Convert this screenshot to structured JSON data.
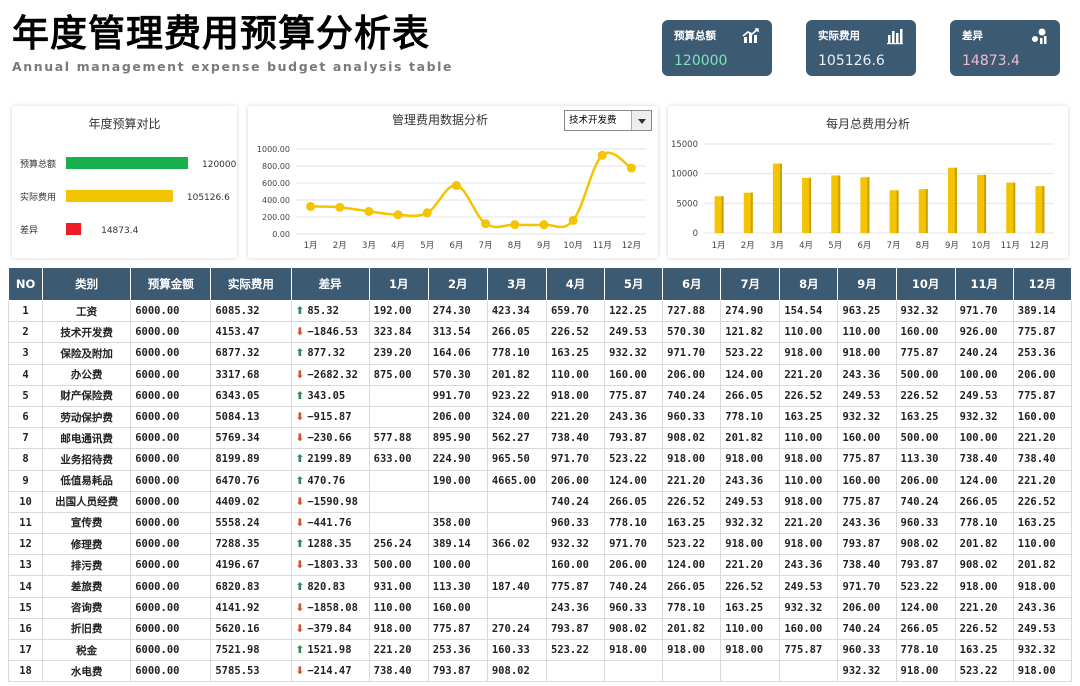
{
  "header": {
    "title": "年度管理费用预算分析表",
    "subtitle": "Annual management expense budget analysis table"
  },
  "kpis": [
    {
      "label": "预算总额",
      "value": "120000",
      "value_color": "#7ee0c0",
      "icon": "bar-chart-icon"
    },
    {
      "label": "实际费用",
      "value": "105126.6",
      "value_color": "#e6f0f5",
      "icon": "column-chart-icon"
    },
    {
      "label": "差异",
      "value": "14873.4",
      "value_color": "#f4b8d8",
      "icon": "scatter-chart-icon"
    }
  ],
  "panel_left": {
    "title": "年度预算对比",
    "items": [
      {
        "label": "预算总额",
        "value": 120000,
        "value_text": "120000",
        "color": "#17b04c"
      },
      {
        "label": "实际费用",
        "value": 105126.6,
        "value_text": "105126.6",
        "color": "#f5c400"
      },
      {
        "label": "差异",
        "value": 14873.4,
        "value_text": "14873.4",
        "color": "#ee1c25"
      }
    ],
    "max": 120000
  },
  "panel_mid": {
    "title": "管理费用数据分析",
    "selected": "技术开发费"
  },
  "panel_right": {
    "title": "每月总费用分析"
  },
  "chart_data": [
    {
      "type": "bar",
      "title": "年度预算对比",
      "categories": [
        "预算总额",
        "实际费用",
        "差异"
      ],
      "values": [
        120000,
        105126.6,
        14873.4
      ]
    },
    {
      "type": "line",
      "title": "管理费用数据分析",
      "series_selector": "技术开发费",
      "categories": [
        "1月",
        "2月",
        "3月",
        "4月",
        "5月",
        "6月",
        "7月",
        "8月",
        "9月",
        "10月",
        "11月",
        "12月"
      ],
      "values": [
        323.84,
        313.54,
        266.05,
        226.52,
        249.53,
        570.3,
        121.82,
        110.0,
        110.0,
        160.0,
        926.0,
        775.87
      ],
      "ylim": [
        0,
        1000
      ],
      "yticks": [
        "1000.00",
        "800.00",
        "600.00",
        "400.00",
        "200.00",
        "0.00"
      ],
      "color": "#f5c400",
      "grid": true
    },
    {
      "type": "bar",
      "title": "每月总费用分析",
      "categories": [
        "1月",
        "2月",
        "3月",
        "4月",
        "5月",
        "6月",
        "7月",
        "8月",
        "9月",
        "10月",
        "11月",
        "12月"
      ],
      "values": [
        6200,
        6800,
        11700,
        9300,
        9700,
        9400,
        7200,
        7400,
        11000,
        9800,
        8500,
        7900
      ],
      "ylim": [
        0,
        15000
      ],
      "yticks": [
        "15000",
        "10000",
        "5000",
        "0"
      ],
      "color": "#f5c400",
      "grid": true
    }
  ],
  "table": {
    "headers": [
      "NO",
      "类别",
      "预算金额",
      "实际费用",
      "差异",
      "1月",
      "2月",
      "3月",
      "4月",
      "5月",
      "6月",
      "7月",
      "8月",
      "9月",
      "10月",
      "11月",
      "12月"
    ],
    "rows": [
      [
        "1",
        "工资",
        "6000.00",
        "6085.32",
        "85.32",
        "192.00",
        "274.30",
        "423.34",
        "659.70",
        "122.25",
        "727.88",
        "274.90",
        "154.54",
        "963.25",
        "932.32",
        "971.70",
        "389.14"
      ],
      [
        "2",
        "技术开发费",
        "6000.00",
        "4153.47",
        "-1846.53",
        "323.84",
        "313.54",
        "266.05",
        "226.52",
        "249.53",
        "570.30",
        "121.82",
        "110.00",
        "110.00",
        "160.00",
        "926.00",
        "775.87"
      ],
      [
        "3",
        "保险及附加",
        "6000.00",
        "6877.32",
        "877.32",
        "239.20",
        "164.06",
        "778.10",
        "163.25",
        "932.32",
        "971.70",
        "523.22",
        "918.00",
        "918.00",
        "775.87",
        "240.24",
        "253.36"
      ],
      [
        "4",
        "办公费",
        "6000.00",
        "3317.68",
        "-2682.32",
        "875.00",
        "570.30",
        "201.82",
        "110.00",
        "160.00",
        "206.00",
        "124.00",
        "221.20",
        "243.36",
        "500.00",
        "100.00",
        "206.00"
      ],
      [
        "5",
        "财产保险费",
        "6000.00",
        "6343.05",
        "343.05",
        "",
        "991.70",
        "923.22",
        "918.00",
        "775.87",
        "740.24",
        "266.05",
        "226.52",
        "249.53",
        "226.52",
        "249.53",
        "775.87"
      ],
      [
        "6",
        "劳动保护费",
        "6000.00",
        "5084.13",
        "-915.87",
        "",
        "206.00",
        "324.00",
        "221.20",
        "243.36",
        "960.33",
        "778.10",
        "163.25",
        "932.32",
        "163.25",
        "932.32",
        "160.00"
      ],
      [
        "7",
        "邮电通讯费",
        "6000.00",
        "5769.34",
        "-230.66",
        "577.88",
        "895.90",
        "562.27",
        "738.40",
        "793.87",
        "908.02",
        "201.82",
        "110.00",
        "160.00",
        "500.00",
        "100.00",
        "221.20"
      ],
      [
        "8",
        "业务招待费",
        "6000.00",
        "8199.89",
        "2199.89",
        "633.00",
        "224.90",
        "965.50",
        "971.70",
        "523.22",
        "918.00",
        "918.00",
        "918.00",
        "775.87",
        "113.30",
        "738.40",
        "738.40"
      ],
      [
        "9",
        "低值易耗品",
        "6000.00",
        "6470.76",
        "470.76",
        "",
        "190.00",
        "4665.00",
        "206.00",
        "124.00",
        "221.20",
        "243.36",
        "110.00",
        "160.00",
        "206.00",
        "124.00",
        "221.20"
      ],
      [
        "10",
        "出国人员经费",
        "6000.00",
        "4409.02",
        "-1590.98",
        "",
        "",
        "",
        "740.24",
        "266.05",
        "226.52",
        "249.53",
        "918.00",
        "775.87",
        "740.24",
        "266.05",
        "226.52"
      ],
      [
        "11",
        "宣传费",
        "6000.00",
        "5558.24",
        "-441.76",
        "",
        "358.00",
        "",
        "960.33",
        "778.10",
        "163.25",
        "932.32",
        "221.20",
        "243.36",
        "960.33",
        "778.10",
        "163.25"
      ],
      [
        "12",
        "修理费",
        "6000.00",
        "7288.35",
        "1288.35",
        "256.24",
        "389.14",
        "366.02",
        "932.32",
        "971.70",
        "523.22",
        "918.00",
        "918.00",
        "793.87",
        "908.02",
        "201.82",
        "110.00"
      ],
      [
        "13",
        "排污费",
        "6000.00",
        "4196.67",
        "-1803.33",
        "500.00",
        "100.00",
        "",
        "160.00",
        "206.00",
        "124.00",
        "221.20",
        "243.36",
        "738.40",
        "793.87",
        "908.02",
        "201.82"
      ],
      [
        "14",
        "差旅费",
        "6000.00",
        "6820.83",
        "820.83",
        "931.00",
        "113.30",
        "187.40",
        "775.87",
        "740.24",
        "266.05",
        "226.52",
        "249.53",
        "971.70",
        "523.22",
        "918.00",
        "918.00"
      ],
      [
        "15",
        "咨询费",
        "6000.00",
        "4141.92",
        "-1858.08",
        "110.00",
        "160.00",
        "",
        "243.36",
        "960.33",
        "778.10",
        "163.25",
        "932.32",
        "206.00",
        "124.00",
        "221.20",
        "243.36"
      ],
      [
        "16",
        "折旧费",
        "6000.00",
        "5620.16",
        "-379.84",
        "918.00",
        "775.87",
        "270.24",
        "793.87",
        "908.02",
        "201.82",
        "110.00",
        "160.00",
        "740.24",
        "266.05",
        "226.52",
        "249.53"
      ],
      [
        "17",
        "税金",
        "6000.00",
        "7521.98",
        "1521.98",
        "221.20",
        "253.36",
        "160.33",
        "523.22",
        "918.00",
        "918.00",
        "918.00",
        "775.87",
        "960.33",
        "778.10",
        "163.25",
        "932.32"
      ],
      [
        "18",
        "水电费",
        "6000.00",
        "5785.53",
        "-214.47",
        "738.40",
        "793.87",
        "908.02",
        "",
        "",
        "",
        "",
        "",
        "932.32",
        "918.00",
        "523.22",
        "918.00"
      ]
    ]
  }
}
